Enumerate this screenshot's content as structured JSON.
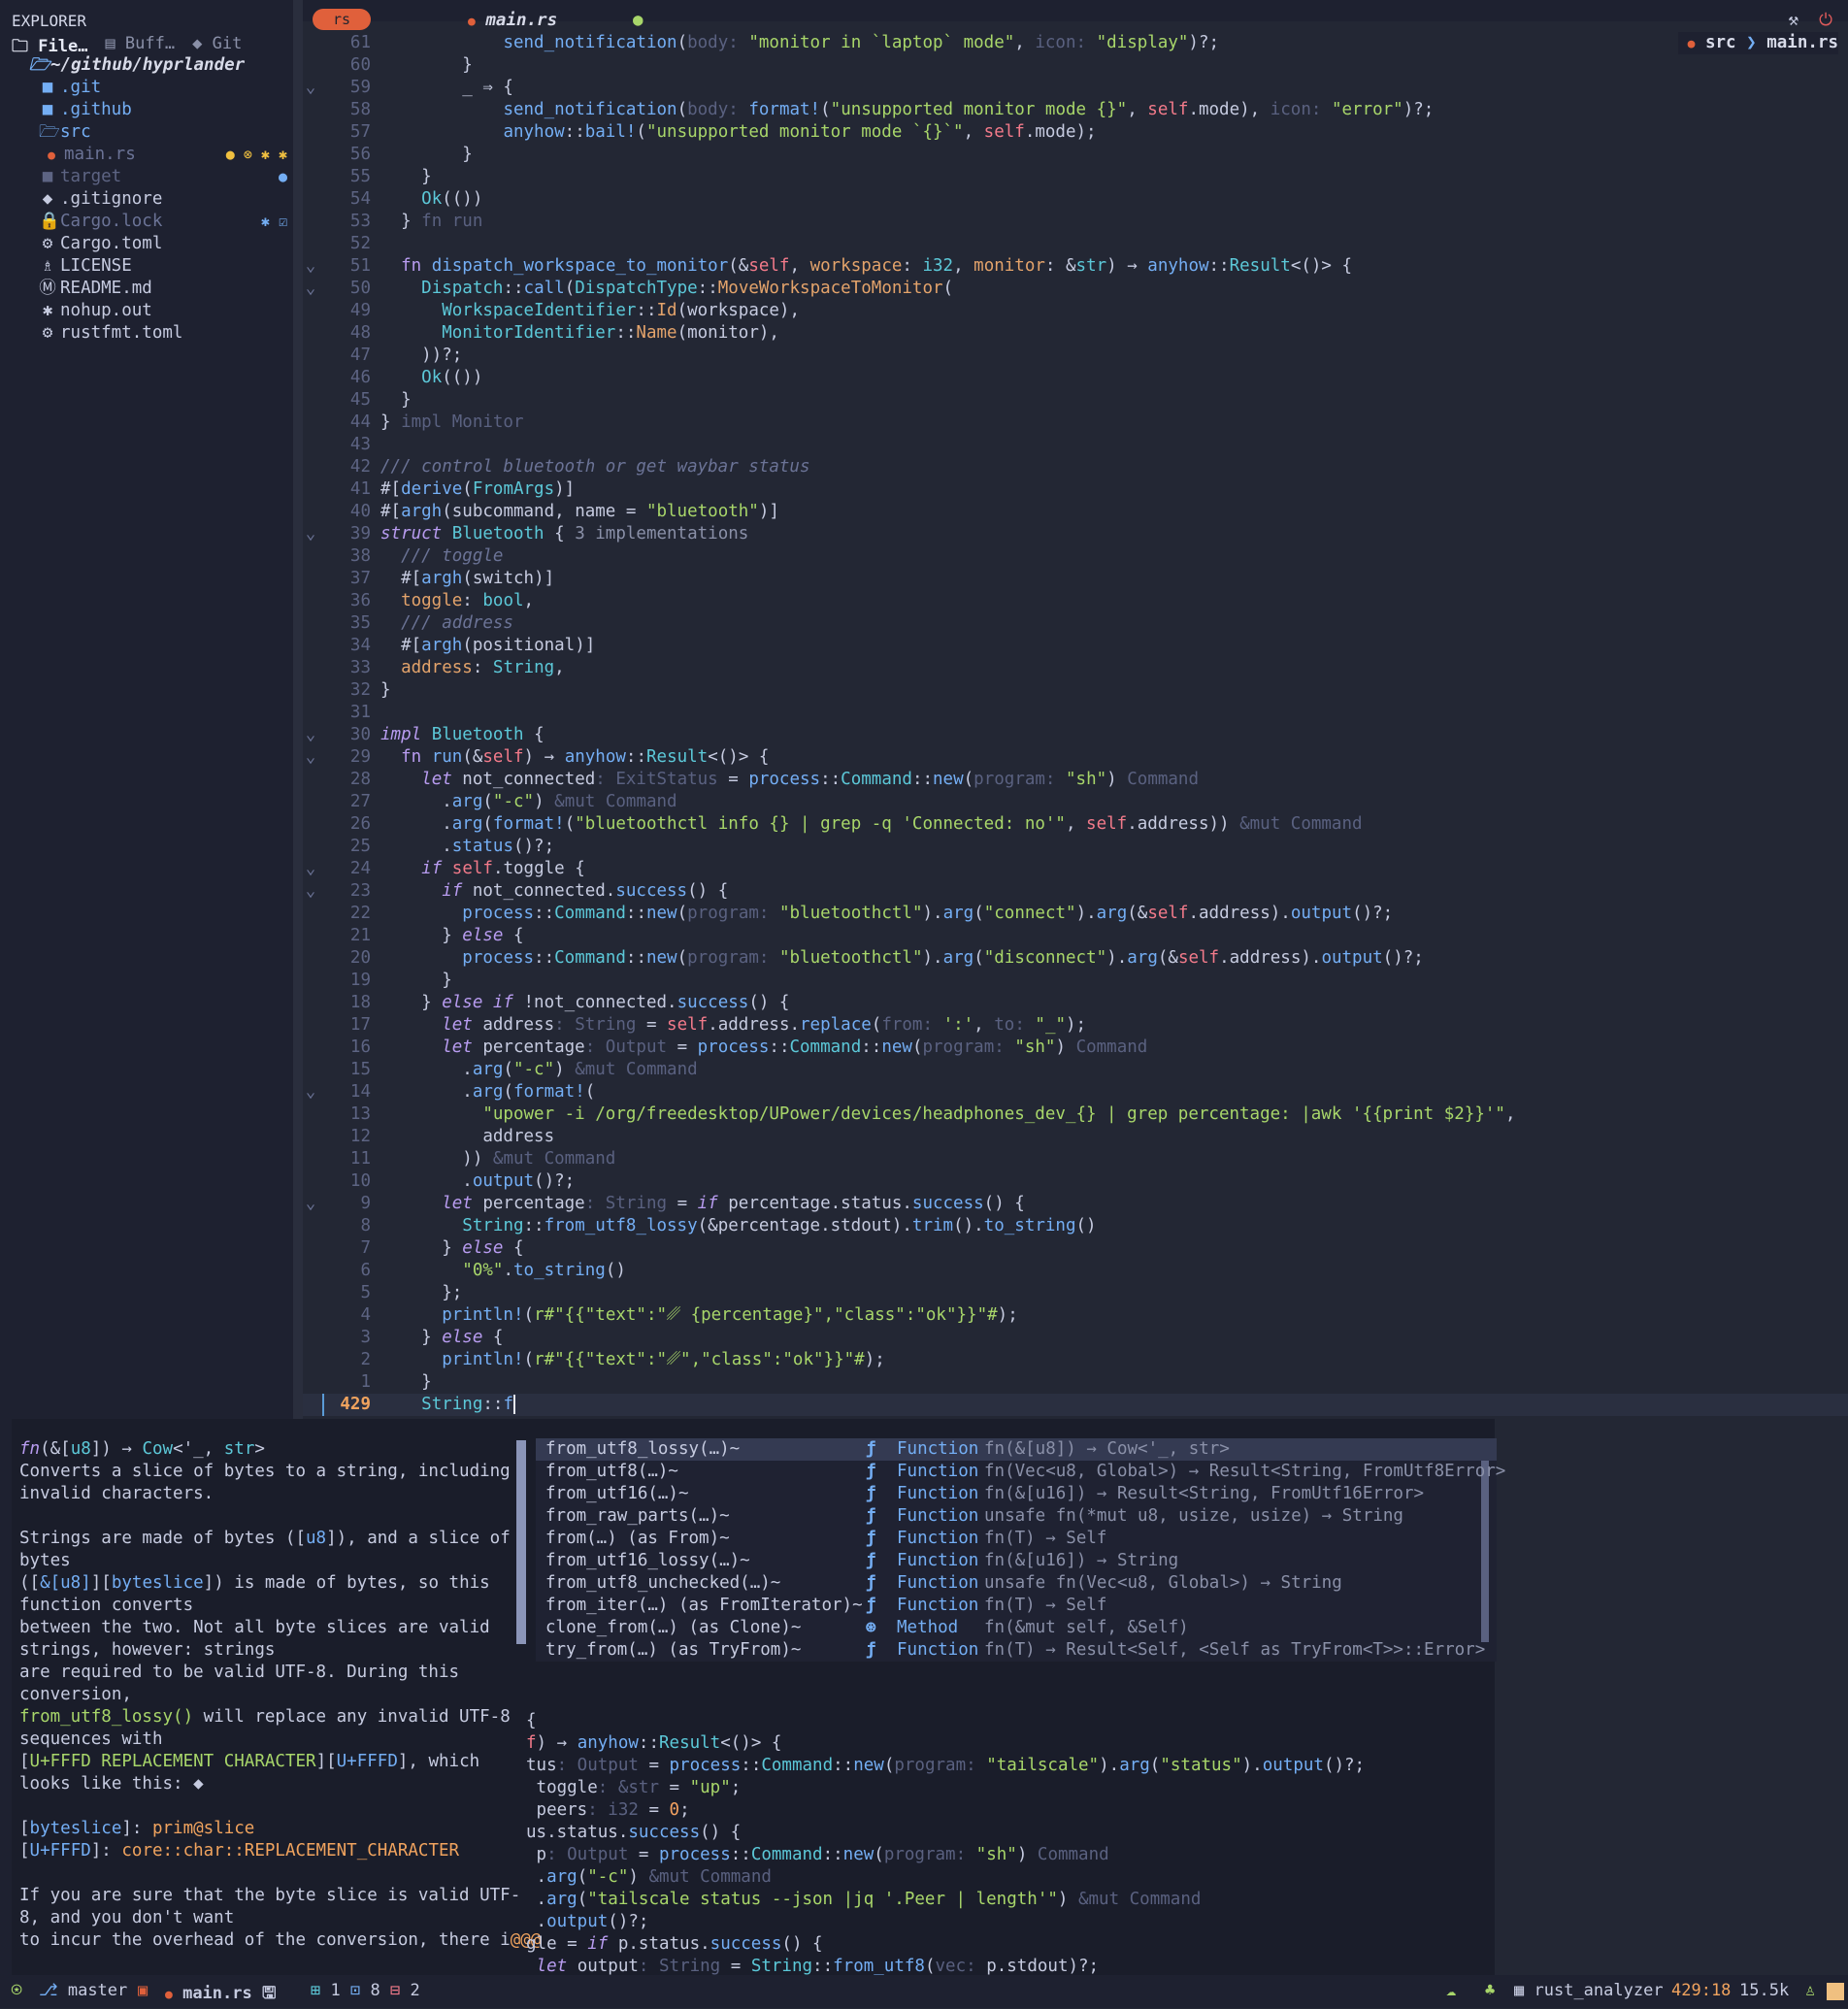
{
  "sidebar": {
    "title": "EXPLORER",
    "tabs": [
      {
        "label": "File…"
      },
      {
        "label": "Buff…"
      },
      {
        "label": "Git"
      }
    ],
    "root": "~/github/hyprlander",
    "items": [
      {
        "name": ".git",
        "icon": "folder-icon",
        "color": "#74aef4"
      },
      {
        "name": ".github",
        "icon": "folder-icon",
        "color": "#74aef4"
      },
      {
        "name": "src",
        "icon": "folder-open-icon",
        "color": "#74aef4"
      },
      {
        "name": "main.rs",
        "icon": "rust-icon",
        "color": "#6b7396",
        "badges": "● ⊗ ✱ ✱"
      },
      {
        "name": "target",
        "icon": "folder-icon",
        "color": "#5d6483",
        "badges": "●"
      },
      {
        "name": ".gitignore",
        "icon": "git-icon",
        "color": "#c6cbe0"
      },
      {
        "name": "Cargo.lock",
        "icon": "lock-icon",
        "color": "#6b7396",
        "badges": "✱ ☑"
      },
      {
        "name": "Cargo.toml",
        "icon": "gear-icon",
        "color": "#c6cbe0"
      },
      {
        "name": "LICENSE",
        "icon": "license-icon",
        "color": "#c6cbe0"
      },
      {
        "name": "README.md",
        "icon": "markdown-icon",
        "color": "#c6cbe0"
      },
      {
        "name": "nohup.out",
        "icon": "file-icon",
        "color": "#c6cbe0"
      },
      {
        "name": "rustfmt.toml",
        "icon": "gear-icon",
        "color": "#c6cbe0"
      }
    ]
  },
  "editor": {
    "tab_lang": "rs",
    "tab_file": "main.rs",
    "breadcrumb": {
      "dir": "src",
      "file": "main.rs"
    },
    "cursor_line": "429",
    "current_text": "String::f"
  },
  "completion": {
    "items": [
      {
        "name": "from_utf8_lossy(…)~",
        "kind": "Function",
        "sig": "fn(&[u8]) → Cow<'_, str>"
      },
      {
        "name": "from_utf8(…)~",
        "kind": "Function",
        "sig": "fn(Vec<u8, Global>) → Result<String, FromUtf8Error>"
      },
      {
        "name": "from_utf16(…)~",
        "kind": "Function",
        "sig": "fn(&[u16]) → Result<String, FromUtf16Error>"
      },
      {
        "name": "from_raw_parts(…)~",
        "kind": "Function",
        "sig": "unsafe fn(*mut u8, usize, usize) → String"
      },
      {
        "name": "from(…) (as From)~",
        "kind": "Function",
        "sig": "fn(T) → Self"
      },
      {
        "name": "from_utf16_lossy(…)~",
        "kind": "Function",
        "sig": "fn(&[u16]) → String"
      },
      {
        "name": "from_utf8_unchecked(…)~",
        "kind": "Function",
        "sig": "unsafe fn(Vec<u8, Global>) → String"
      },
      {
        "name": "from_iter(…) (as FromIterator)~",
        "kind": "Function",
        "sig": "fn(T) → Self"
      },
      {
        "name": "clone_from(…) (as Clone)~",
        "kind": "Method",
        "sig": "fn(&mut self, &Self)"
      },
      {
        "name": "try_from(…) (as TryFrom)~",
        "kind": "Function",
        "sig": "fn(T) → Result<Self, <Self as TryFrom<T>>::Error>"
      }
    ]
  },
  "statusbar": {
    "branch": "master",
    "file": "main.rs",
    "add": "1",
    "mod": "8",
    "del": "2",
    "lsp": "rust_analyzer",
    "pos": "429:18",
    "size": "15.5k"
  }
}
